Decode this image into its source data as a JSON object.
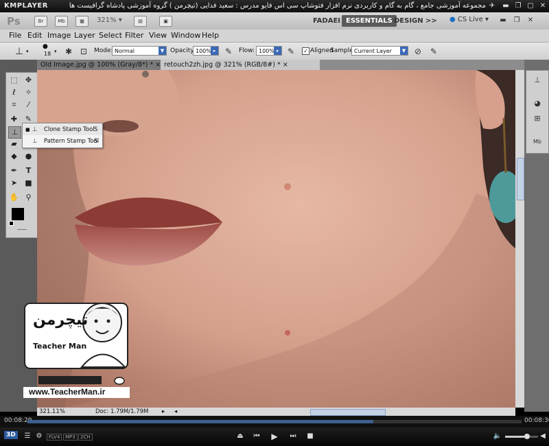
{
  "kmplayer": {
    "logo": "KMPLAYER",
    "caption": "مجموعه آموزشی جامع ، گام به گام و کاربردی نرم افزار فتوشاپ سی اس فایو  مدرس : سعید فدایی (تیچرمن ) گروه آموزشی پادشاه گرافیست ها",
    "elapsed": "00:08:29",
    "total": "00:08:30",
    "progress": 0.7,
    "badges": [
      "FLV4",
      "MP3",
      "2CH"
    ],
    "badge_3d": "3D"
  },
  "photoshop": {
    "logo": "Ps",
    "zoom": "321%",
    "workspaces": [
      "FADAEI",
      "ESSENTIALS",
      "DESIGN"
    ],
    "more": ">>",
    "cs_live": "CS Live",
    "menu": [
      "File",
      "Edit",
      "Image",
      "Layer",
      "Select",
      "Filter",
      "View",
      "Window",
      "Help"
    ],
    "options": {
      "brush_size": "18",
      "mode_label": "Mode:",
      "mode_value": "Normal",
      "opacity_label": "Opacity:",
      "opacity_value": "100%",
      "flow_label": "Flow:",
      "flow_value": "100%",
      "aligned_label": "Aligned",
      "sample_label": "Sample:",
      "sample_value": "Current Layer"
    },
    "tabs": [
      {
        "label": "Old Image.jpg @ 100% (Gray/8*) *",
        "close": "×"
      },
      {
        "label": "retouch2zh.jpg @ 321% (RGB/8#) *",
        "close": "×"
      }
    ],
    "popup": [
      {
        "label": "Clone Stamp Tool",
        "key": "S"
      },
      {
        "label": "Pattern Stamp Tool",
        "key": "S"
      }
    ],
    "status": {
      "zoom": "321.11%",
      "doc": "Doc: 1.79M/1.79M"
    }
  },
  "watermark": {
    "persian": "تیچرمن",
    "subtitle": "Teacher Man",
    "url": "www.TeacherMan.ir"
  }
}
